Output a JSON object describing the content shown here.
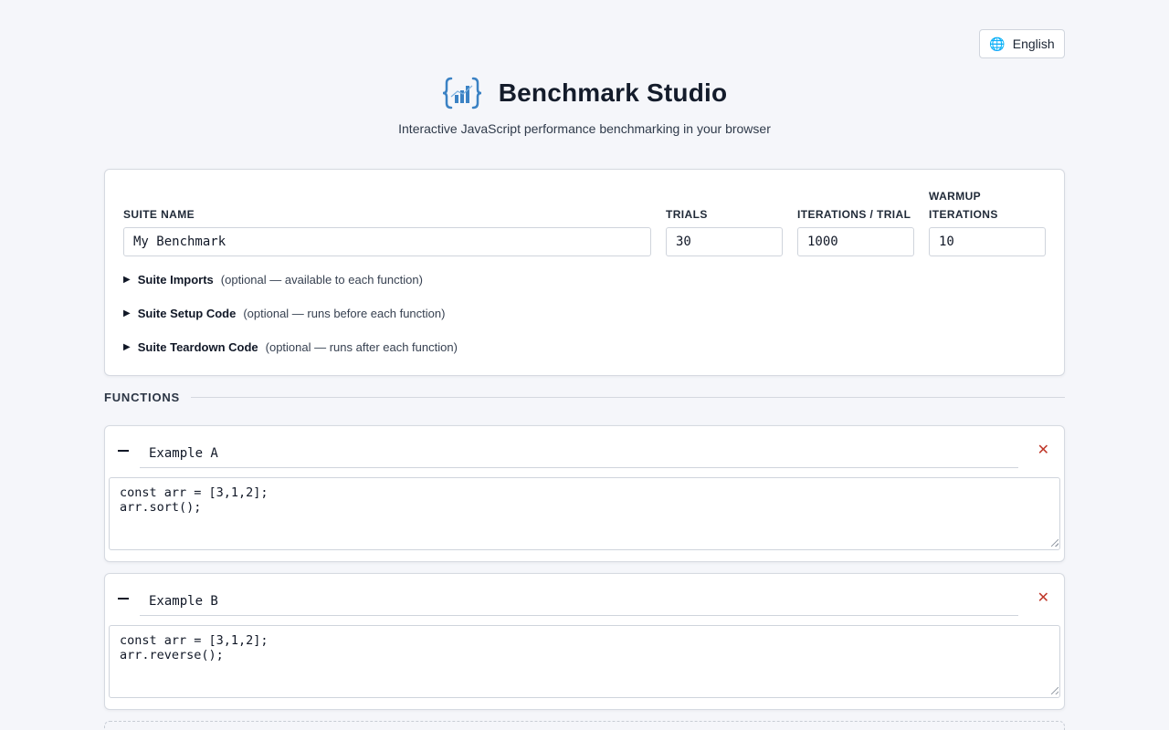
{
  "language": {
    "label": "English",
    "icon": "globe-icon"
  },
  "app": {
    "title": "Benchmark Studio",
    "subtitle": "Interactive JavaScript performance benchmarking in your browser",
    "accent": "#3b82c4"
  },
  "suite": {
    "name_label": "Suite Name",
    "name_value": "My Benchmark",
    "trials_label": "Trials",
    "trials_value": "30",
    "iterations_label": "Iterations / Trial",
    "iterations_value": "1000",
    "warmup_label_1": "Warmup",
    "warmup_label_2": "Iterations",
    "warmup_value": "10",
    "sections": [
      {
        "title": "Suite Imports",
        "hint": "(optional — available to each function)"
      },
      {
        "title": "Suite Setup Code",
        "hint": "(optional — runs before each function)"
      },
      {
        "title": "Suite Teardown Code",
        "hint": "(optional — runs after each function)"
      }
    ]
  },
  "functions_title": "Functions",
  "functions": [
    {
      "name": "Example A",
      "code": "const arr = [3,1,2];\narr.sort();",
      "delete_label": "✕",
      "delete_color": "#c0392b"
    },
    {
      "name": "Example B",
      "code": "const arr = [3,1,2];\narr.reverse();",
      "delete_label": "✕",
      "delete_color": "#c0392b"
    }
  ]
}
